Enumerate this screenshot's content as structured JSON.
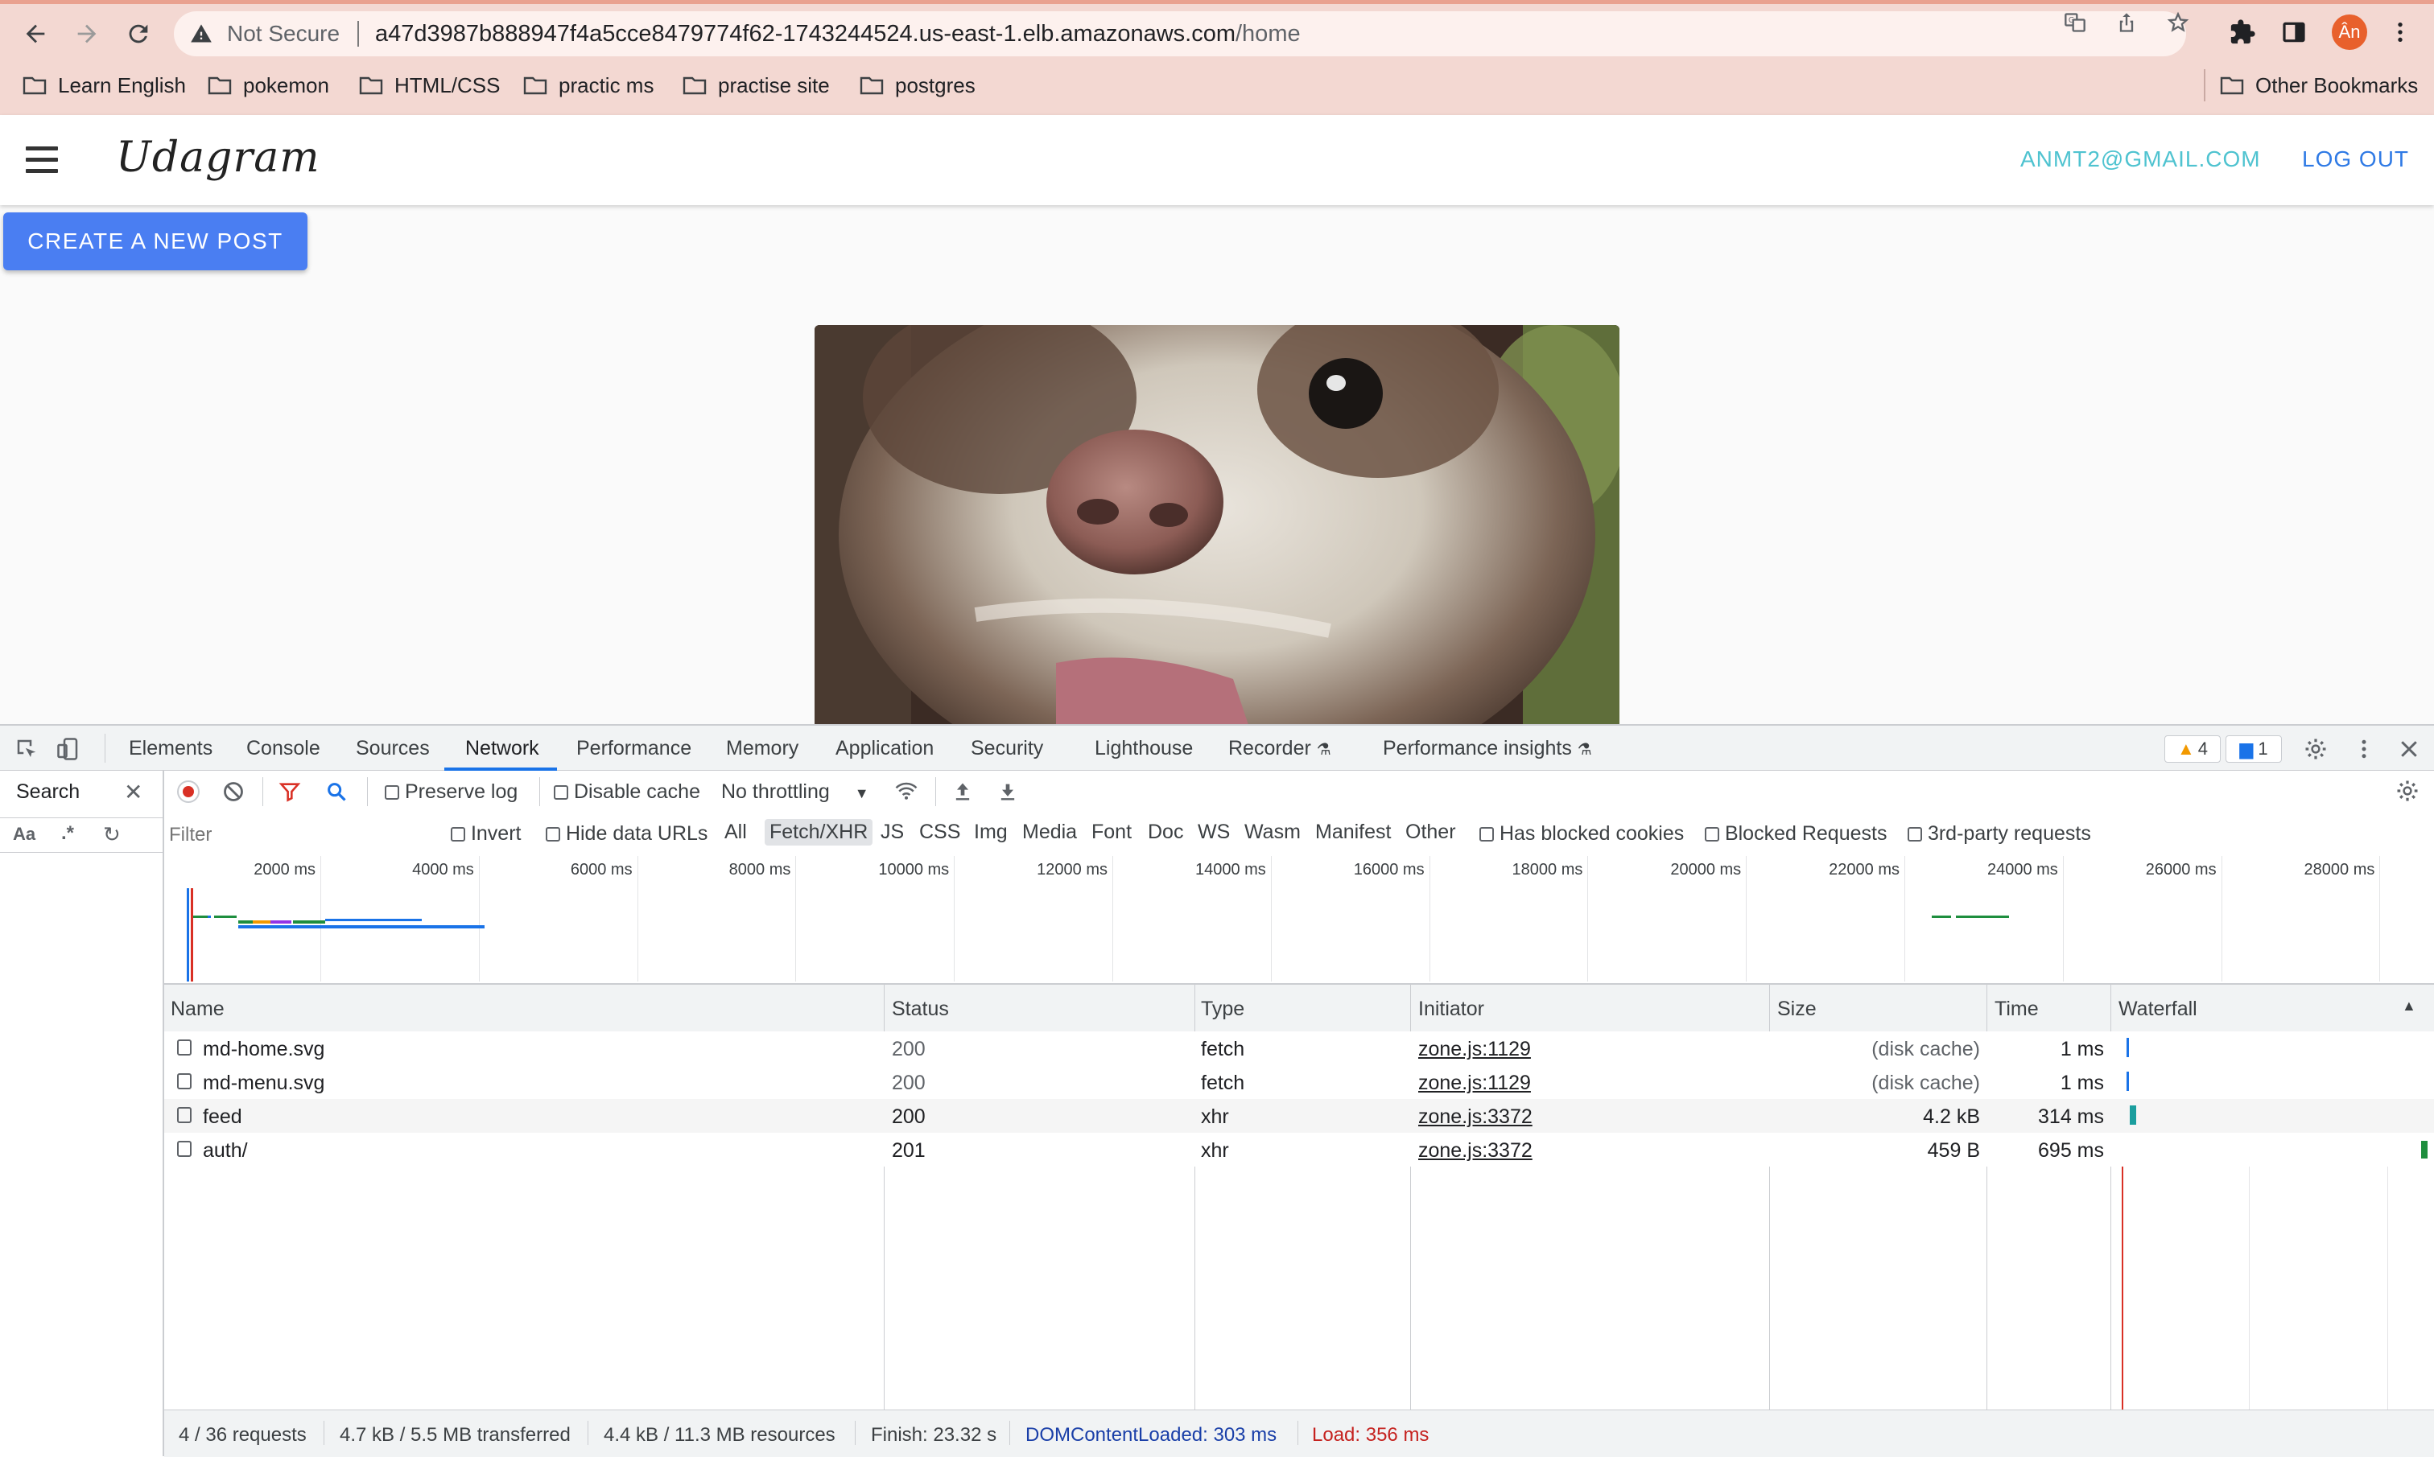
{
  "browser": {
    "not_secure_label": "Not Secure",
    "url_host": "a47d3987b888947f4a5cce8479774f62-1743244524.us-east-1.elb.amazonaws.com",
    "url_path": "/home",
    "avatar_text": "Ân",
    "bookmarks": [
      "Learn English",
      "pokemon",
      "HTML/CSS",
      "practic ms",
      "practise site",
      "postgres"
    ],
    "other_bookmarks": "Other Bookmarks"
  },
  "app": {
    "brand": "Udagram",
    "user_email": "ANMT2@GMAIL.COM",
    "logout": "LOG OUT",
    "create_post": "CREATE A NEW POST",
    "accent_color": "#4a7ef2"
  },
  "devtools": {
    "tabs": [
      "Elements",
      "Console",
      "Sources",
      "Network",
      "Performance",
      "Memory",
      "Application",
      "Security",
      "Lighthouse",
      "Recorder",
      "Performance insights"
    ],
    "active_tab": "Network",
    "warnings_count": "4",
    "messages_count": "1",
    "search": {
      "label": "Search",
      "case_label": "Aa",
      "regex_label": ".*"
    },
    "toolbar": {
      "preserve_log": "Preserve log",
      "disable_cache": "Disable cache",
      "throttling": "No throttling"
    },
    "filter": {
      "placeholder": "Filter",
      "invert": "Invert",
      "hide_data_urls": "Hide data URLs",
      "types": [
        "All",
        "Fetch/XHR",
        "JS",
        "CSS",
        "Img",
        "Media",
        "Font",
        "Doc",
        "WS",
        "Wasm",
        "Manifest",
        "Other"
      ],
      "active_type": "Fetch/XHR",
      "has_blocked_cookies": "Has blocked cookies",
      "blocked_requests": "Blocked Requests",
      "third_party": "3rd-party requests"
    },
    "overview_ticks": [
      "2000 ms",
      "4000 ms",
      "6000 ms",
      "8000 ms",
      "10000 ms",
      "12000 ms",
      "14000 ms",
      "16000 ms",
      "18000 ms",
      "20000 ms",
      "22000 ms",
      "24000 ms",
      "26000 ms",
      "28000 ms"
    ],
    "columns": [
      "Name",
      "Status",
      "Type",
      "Initiator",
      "Size",
      "Time",
      "Waterfall"
    ],
    "rows": [
      {
        "name": "md-home.svg",
        "status": "200",
        "type": "fetch",
        "initiator": "zone.js:1129",
        "size": "(disk cache)",
        "time": "1 ms"
      },
      {
        "name": "md-menu.svg",
        "status": "200",
        "type": "fetch",
        "initiator": "zone.js:1129",
        "size": "(disk cache)",
        "time": "1 ms"
      },
      {
        "name": "feed",
        "status": "200",
        "type": "xhr",
        "initiator": "zone.js:3372",
        "size": "4.2 kB",
        "time": "314 ms"
      },
      {
        "name": "auth/",
        "status": "201",
        "type": "xhr",
        "initiator": "zone.js:3372",
        "size": "459 B",
        "time": "695 ms"
      }
    ],
    "status_bar": {
      "requests": "4 / 36 requests",
      "transferred": "4.7 kB / 5.5 MB transferred",
      "resources": "4.4 kB / 11.3 MB resources",
      "finish": "Finish: 23.32 s",
      "dom_content_loaded": "DOMContentLoaded: 303 ms",
      "load": "Load: 356 ms",
      "dcl_color": "#1a3fa8",
      "load_color": "#c5221f"
    }
  }
}
